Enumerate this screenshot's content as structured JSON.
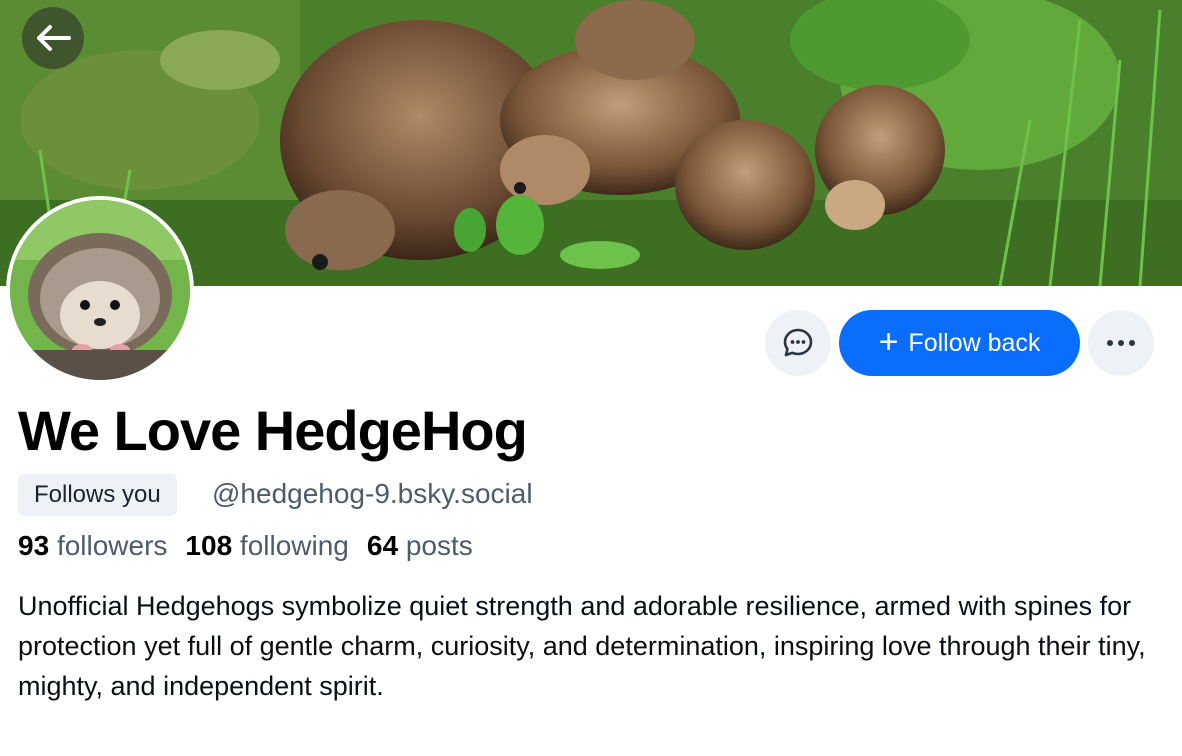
{
  "navigation": {
    "back_icon": "arrow-left-icon"
  },
  "profile": {
    "display_name": "We Love HedgeHog",
    "follows_you_label": "Follows you",
    "handle": "@hedgehog-9.bsky.social",
    "bio": "Unofficial Hedgehogs symbolize quiet strength and adorable resilience, armed with spines for protection yet full of gentle charm, curiosity, and determination, inspiring love through their tiny, mighty, and independent spirit."
  },
  "stats": {
    "followers_count": "93",
    "followers_label": "followers",
    "following_count": "108",
    "following_label": "following",
    "posts_count": "64",
    "posts_label": "posts"
  },
  "actions": {
    "message_icon": "chat-bubble-icon",
    "follow_label": "Follow back",
    "follow_icon": "plus-icon",
    "more_icon": "ellipsis-icon"
  },
  "colors": {
    "accent": "#0a6dfb",
    "muted_text": "#4d5b6b",
    "button_bg": "#eef1f5"
  }
}
